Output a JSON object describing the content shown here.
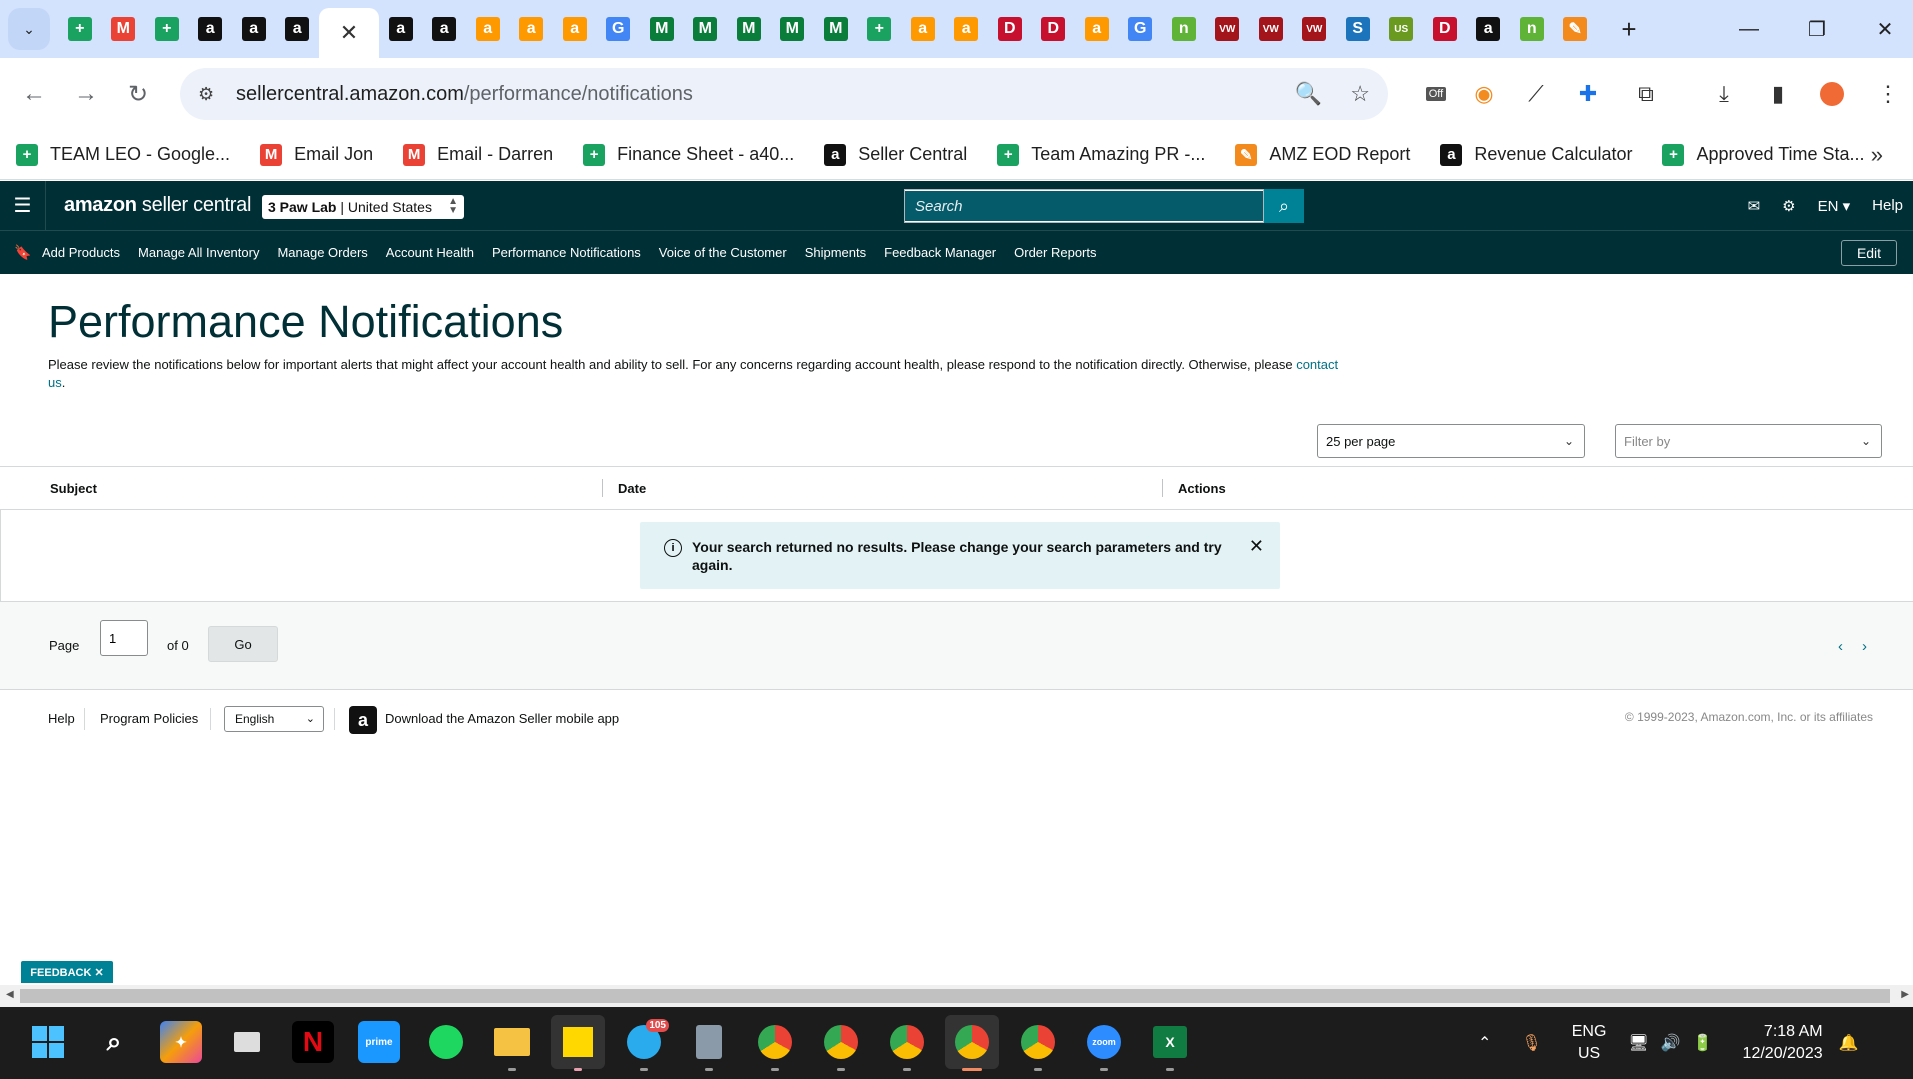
{
  "browser": {
    "tab_icons": [
      {
        "name": "sheets-tab-icon",
        "glyph": "+",
        "bg": "#1aa260"
      },
      {
        "name": "gmail-tab-icon",
        "glyph": "M",
        "bg": "#ea4335"
      },
      {
        "name": "sheets-tab-icon",
        "glyph": "+",
        "bg": "#1aa260"
      },
      {
        "name": "amazon-tab-icon",
        "glyph": "a",
        "bg": "#111111"
      },
      {
        "name": "amazon-tab-icon",
        "glyph": "a",
        "bg": "#111111"
      },
      {
        "name": "amazon-tab-icon",
        "glyph": "a",
        "bg": "#111111"
      }
    ],
    "tab_icons_after": [
      {
        "name": "amazon-tab-icon",
        "glyph": "a",
        "bg": "#111111"
      },
      {
        "name": "amazon-tab-icon",
        "glyph": "a",
        "bg": "#111111"
      },
      {
        "name": "amazon-tab-icon",
        "glyph": "a",
        "bg": "#ff9900"
      },
      {
        "name": "amazon-tab-icon",
        "glyph": "a",
        "bg": "#ff9900"
      },
      {
        "name": "amazon-tab-icon",
        "glyph": "a",
        "bg": "#ff9900"
      },
      {
        "name": "google-tab-icon",
        "glyph": "G",
        "bg": "#4285f4"
      },
      {
        "name": "m-tab-icon",
        "glyph": "M",
        "bg": "#0a7d3a"
      },
      {
        "name": "m-tab-icon",
        "glyph": "M",
        "bg": "#0a7d3a"
      },
      {
        "name": "m-tab-icon",
        "glyph": "M",
        "bg": "#0a7d3a"
      },
      {
        "name": "m-tab-icon",
        "glyph": "M",
        "bg": "#0a7d3a"
      },
      {
        "name": "m-tab-icon",
        "glyph": "M",
        "bg": "#0a7d3a"
      },
      {
        "name": "sheets-tab-icon",
        "glyph": "+",
        "bg": "#1aa260"
      },
      {
        "name": "amazon-tab-icon",
        "glyph": "a",
        "bg": "#ff9900"
      },
      {
        "name": "amazon-tab-icon",
        "glyph": "a",
        "bg": "#ff9900"
      },
      {
        "name": "d-tab-icon",
        "glyph": "D",
        "bg": "#c7102e"
      },
      {
        "name": "d-tab-icon",
        "glyph": "D",
        "bg": "#c7102e"
      },
      {
        "name": "amazon-tab-icon",
        "glyph": "a",
        "bg": "#ff9900"
      },
      {
        "name": "google-tab-icon",
        "glyph": "G",
        "bg": "#4285f4"
      },
      {
        "name": "n-tab-icon",
        "glyph": "n",
        "bg": "#5fb336"
      },
      {
        "name": "vw-tab-icon",
        "glyph": "VW",
        "bg": "#a4141b"
      },
      {
        "name": "vw-tab-icon",
        "glyph": "VW",
        "bg": "#a4141b"
      },
      {
        "name": "vw-tab-icon",
        "glyph": "VW",
        "bg": "#a4141b"
      },
      {
        "name": "sysco-tab-icon",
        "glyph": "S",
        "bg": "#1c75bc"
      },
      {
        "name": "usfoods-tab-icon",
        "glyph": "US",
        "bg": "#6a9a1f"
      },
      {
        "name": "d-tab-icon",
        "glyph": "D",
        "bg": "#c7102e"
      },
      {
        "name": "amazon-tab-icon",
        "glyph": "a",
        "bg": "#111111"
      },
      {
        "name": "n-tab-icon",
        "glyph": "n",
        "bg": "#5fb336"
      },
      {
        "name": "pen-tab-icon",
        "glyph": "✎",
        "bg": "#f38a1d"
      }
    ],
    "active_tab_close": "✕",
    "new_tab": "+",
    "url_host": "sellercentral.amazon.com",
    "url_path": "/performance/notifications",
    "ext_off_label": "Off",
    "bookmarks": [
      {
        "icon": "sheets-icon",
        "glyph": "+",
        "bg": "#1aa260",
        "label": "TEAM LEO - Google..."
      },
      {
        "icon": "gmail-icon",
        "glyph": "M",
        "bg": "#ea4335",
        "label": "Email Jon"
      },
      {
        "icon": "gmail-icon",
        "glyph": "M",
        "bg": "#ea4335",
        "label": "Email - Darren"
      },
      {
        "icon": "sheets-icon",
        "glyph": "+",
        "bg": "#1aa260",
        "label": "Finance Sheet - a40..."
      },
      {
        "icon": "amazon-icon",
        "glyph": "a",
        "bg": "#111111",
        "label": "Seller Central"
      },
      {
        "icon": "sheets-icon",
        "glyph": "+",
        "bg": "#1aa260",
        "label": "Team Amazing PR -..."
      },
      {
        "icon": "pen-icon",
        "glyph": "✎",
        "bg": "#f38a1d",
        "label": "AMZ EOD Report"
      },
      {
        "icon": "amazon-icon",
        "glyph": "a",
        "bg": "#111111",
        "label": "Revenue Calculator"
      },
      {
        "icon": "sheets-icon",
        "glyph": "+",
        "bg": "#1aa260",
        "label": "Approved Time Sta..."
      }
    ],
    "bookmarks_more": "»"
  },
  "sc": {
    "logo_bold": "amazon",
    "logo_rest": " seller central",
    "store": "3 Paw Lab",
    "marketplace": "United States",
    "search_placeholder": "Search",
    "lang": "EN",
    "help": "Help",
    "nav": [
      "Add Products",
      "Manage All Inventory",
      "Manage Orders",
      "Account Health",
      "Performance Notifications",
      "Voice of the Customer",
      "Shipments",
      "Feedback Manager",
      "Order Reports"
    ],
    "edit": "Edit"
  },
  "main": {
    "title": "Performance Notifications",
    "intro_text": "Please review the notifications below for important alerts that might affect your account health and ability to sell. For any concerns regarding account health, please respond to the notification directly. Otherwise, please ",
    "intro_link": "contact us",
    "intro_end": ".",
    "per_page": "25 per page",
    "filter_placeholder": "Filter by",
    "columns": [
      "Subject",
      "Date",
      "Actions"
    ],
    "no_results": "Your search returned no results. Please change your search parameters and try again.",
    "page_label": "Page",
    "page_value": "1",
    "of_label": "of 0",
    "go": "Go"
  },
  "footer": {
    "help": "Help",
    "policies": "Program Policies",
    "language": "English",
    "app_text": "Download the Amazon Seller mobile app",
    "copyright": "© 1999-2023, Amazon.com, Inc. or its affiliates"
  },
  "feedback": "FEEDBACK ✕",
  "taskbar": {
    "lang_top": "ENG",
    "lang_bottom": "US",
    "time": "7:18 AM",
    "date": "12/20/2023",
    "telegram_badge": "105"
  }
}
